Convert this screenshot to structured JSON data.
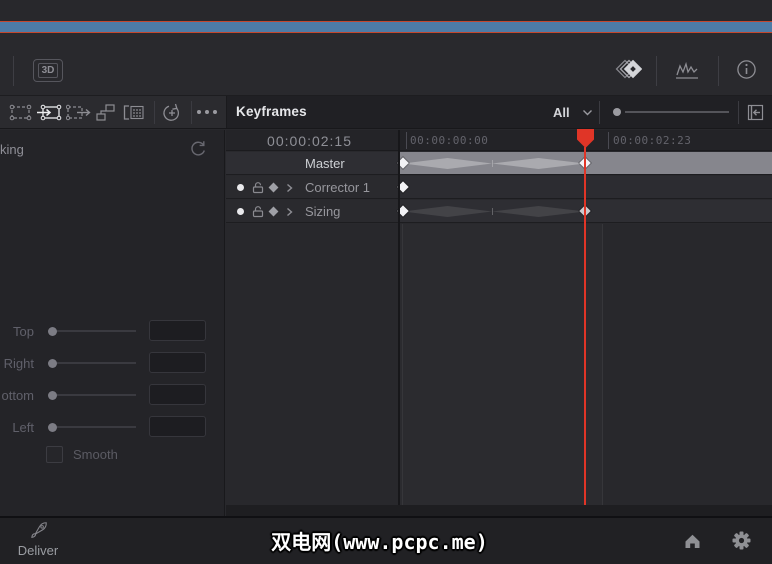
{
  "colors": {
    "background": "#28282c",
    "accent_blue_bar": "#4d7ba6",
    "accent_red_border": "#c4472e",
    "playhead_red": "#e03527",
    "master_row_gray": "#86868d",
    "bottom_bar": "#212124"
  },
  "toolbar": {
    "button_3d_label": "3D",
    "right_icons": [
      {
        "name": "keyframes-stack-icon",
        "active": true
      },
      {
        "name": "curves-icon",
        "active": false
      },
      {
        "name": "info-icon",
        "active": false
      }
    ]
  },
  "tools_row": {
    "window_tools": [
      {
        "name": "marquee-window-tool",
        "active": false
      },
      {
        "name": "window-arrow-in-tool",
        "active": true
      },
      {
        "name": "window-arrow-out-tool",
        "active": false
      },
      {
        "name": "node-link-tool",
        "active": false
      },
      {
        "name": "matte-window-tool",
        "active": false
      }
    ],
    "reset_icon": "reset-add-icon",
    "more_icon": "more-dots-icon"
  },
  "keyframes_panel": {
    "title": "Keyframes",
    "filter_value": "All",
    "current_timecode": "00:00:02:15",
    "ruler": [
      {
        "label": "00:00:00:00"
      },
      {
        "label": "00:00:02:23"
      }
    ],
    "tracks": [
      {
        "name": "Master",
        "highlighted": true,
        "keyframes": [
          "start",
          "playhead"
        ],
        "has_interpolation_spindles": true
      },
      {
        "name": "Corrector 1",
        "highlighted": false,
        "keyframes": [
          "start"
        ],
        "has_interpolation_spindles": false
      },
      {
        "name": "Sizing",
        "highlighted": false,
        "keyframes": [
          "start",
          "playhead"
        ],
        "has_interpolation_spindles": true
      }
    ],
    "collapse_icon": "collapse-panel-left-icon"
  },
  "left_panel": {
    "header_text": "king",
    "reset_icon": "reset-icon",
    "sliders": [
      {
        "label": "Top",
        "value": ""
      },
      {
        "label": "Right",
        "value": ""
      },
      {
        "label": "ottom",
        "value": ""
      },
      {
        "label": "Left",
        "value": ""
      }
    ],
    "checkbox_label": "Smooth",
    "checkbox_checked": false
  },
  "bottom_bar": {
    "page_label": "Deliver",
    "watermark": "双电网(www.pcpc.me)",
    "right_icons": [
      {
        "name": "home-icon"
      },
      {
        "name": "gear-icon"
      }
    ]
  }
}
